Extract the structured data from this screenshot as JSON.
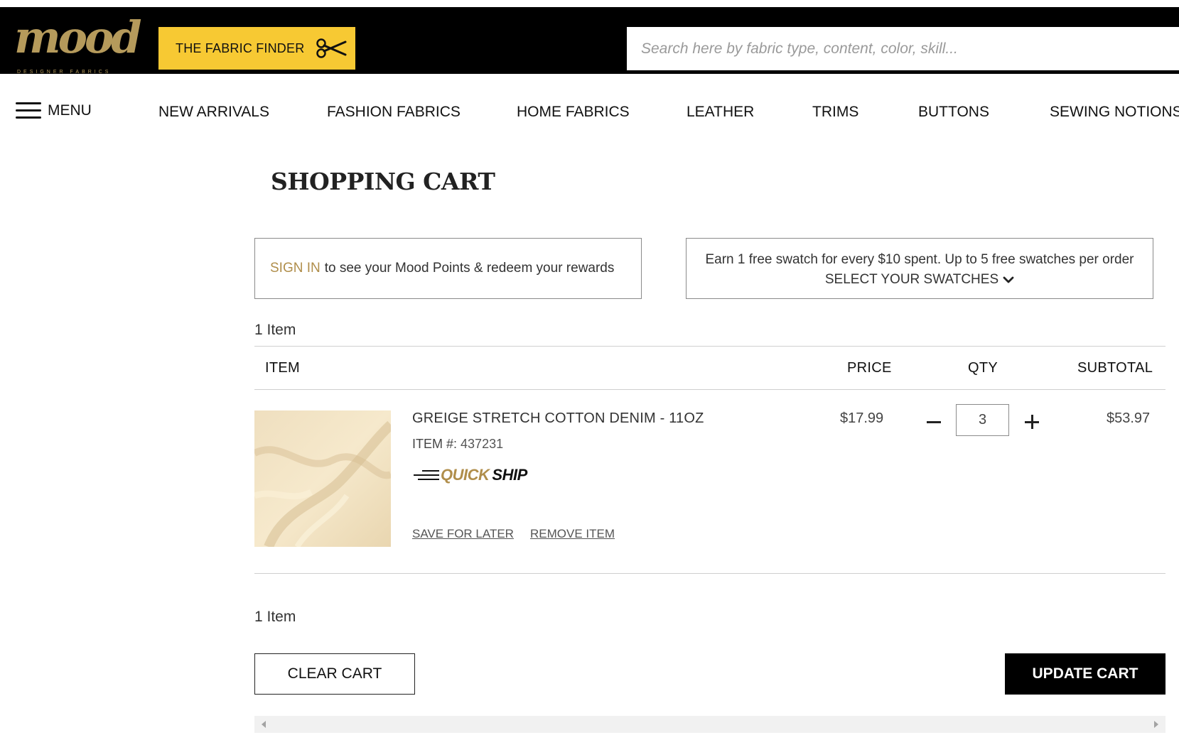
{
  "header": {
    "logo_text": "mood",
    "logo_subtext": "DESIGNER FABRICS",
    "fabric_finder_label": "THE FABRIC FINDER",
    "fabric_finder_icon": "scissors-icon",
    "search_placeholder": "Search here by fabric type, content, color, skill...",
    "accent_color": "#f7c933",
    "brand_gold": "#b08e4b"
  },
  "nav": {
    "menu_label": "MENU",
    "items": [
      "NEW ARRIVALS",
      "FASHION FABRICS",
      "HOME FABRICS",
      "LEATHER",
      "TRIMS",
      "BUTTONS",
      "SEWING NOTIONS"
    ]
  },
  "cart": {
    "title": "SHOPPING CART",
    "signin_link": "SIGN IN",
    "signin_text": "to see your Mood Points & redeem your rewards",
    "swatch_text": "Earn 1 free swatch for every $10 spent. Up to 5 free swatches per order",
    "swatch_link": "SELECT YOUR SWATCHES",
    "item_count_top": "1 Item",
    "item_count_bottom": "1 Item",
    "columns": {
      "item": "ITEM",
      "price": "PRICE",
      "qty": "QTY",
      "subtotal": "SUBTOTAL"
    },
    "items": [
      {
        "name": "GREIGE STRETCH COTTON DENIM - 11OZ",
        "sku_label": "ITEM #:",
        "sku": "437231",
        "badge_quick": "QUICK",
        "badge_ship": "SHIP",
        "price": "$17.99",
        "qty": "3",
        "subtotal": "$53.97",
        "save_for_later": "SAVE FOR LATER",
        "remove_item": "REMOVE ITEM"
      }
    ],
    "clear_cart_label": "CLEAR CART",
    "update_cart_label": "UPDATE CART"
  }
}
